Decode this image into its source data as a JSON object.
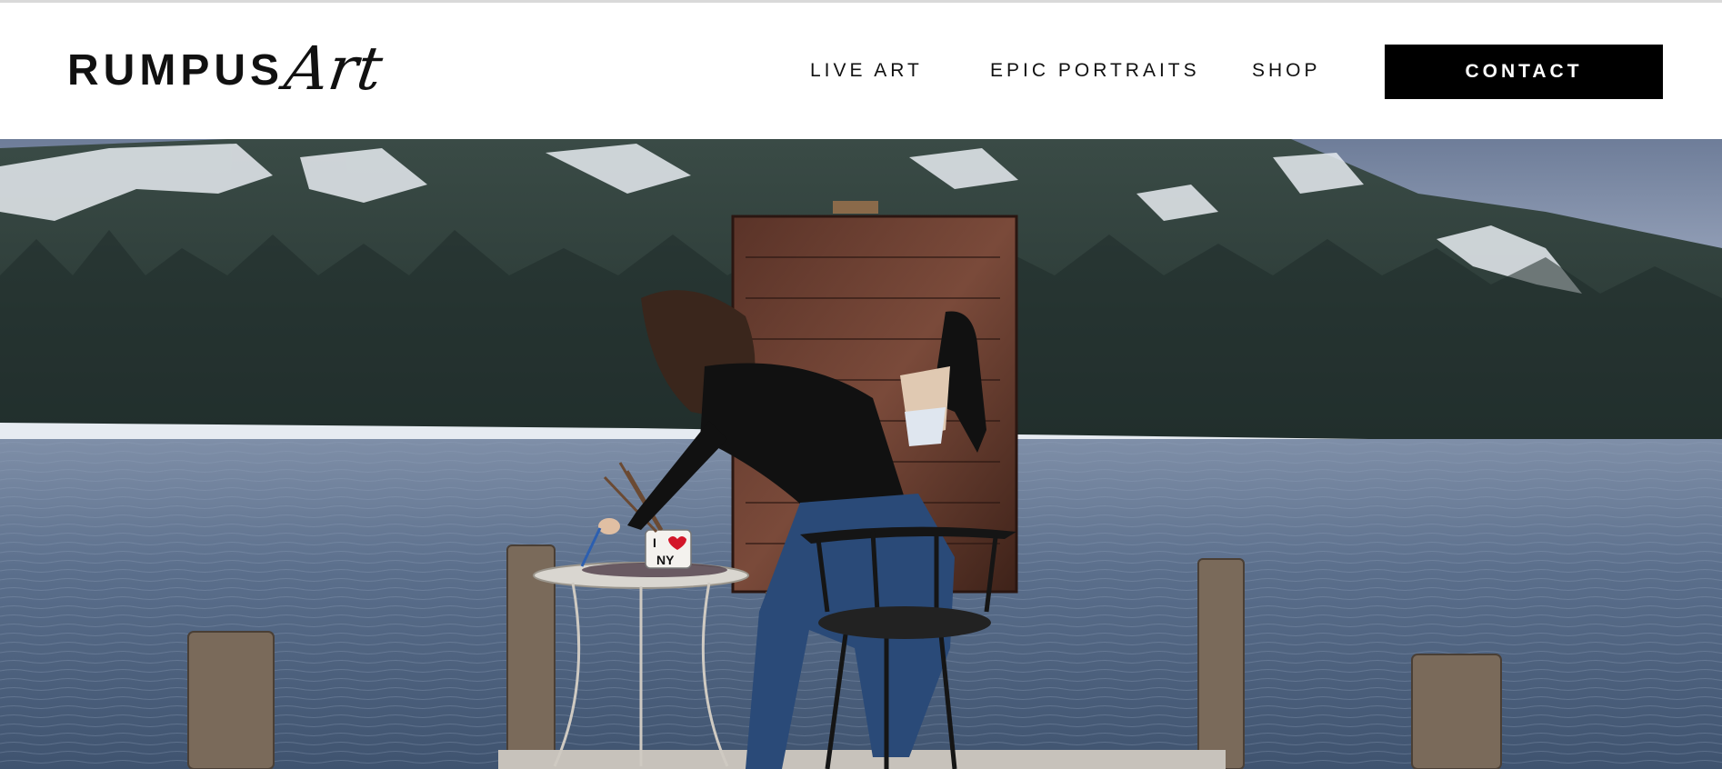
{
  "brand": {
    "logo_text": "RUMPUS",
    "logo_script": "Art"
  },
  "nav": {
    "items": [
      {
        "label": "LIVE ART"
      },
      {
        "label": "EPIC PORTRAITS"
      },
      {
        "label": "SHOP"
      }
    ],
    "cta_label": "CONTACT"
  },
  "hero": {
    "mug_text_top": "I",
    "mug_text_bottom": "NY"
  },
  "colors": {
    "cta_background": "#000000",
    "cta_text": "#ffffff",
    "header_background": "#ffffff",
    "water": "#4f6580",
    "sky": "#7a8aa6"
  }
}
